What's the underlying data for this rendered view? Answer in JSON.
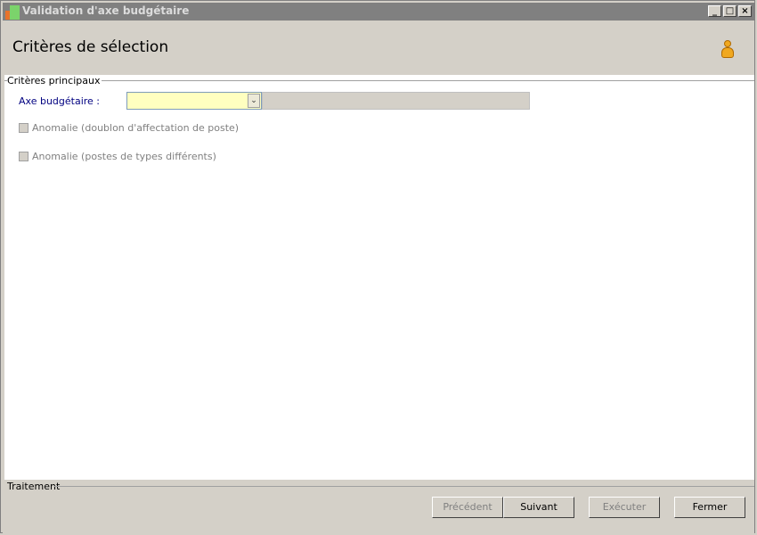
{
  "window": {
    "title": "Validation d'axe budgétaire",
    "buttons": {
      "minimize": "_",
      "maximize": "□",
      "close": "×"
    }
  },
  "header": {
    "title": "Critères de sélection",
    "icon": "user-icon"
  },
  "main": {
    "group_label": "Critères principaux",
    "axe_label": "Axe budgétaire :",
    "axe_value": "",
    "axe_description": "",
    "checkboxes": [
      {
        "label": "Anomalie (doublon d'affectation de poste)",
        "checked": false,
        "enabled": false
      },
      {
        "label": "Anomalie (postes de types différents)",
        "checked": false,
        "enabled": false
      }
    ]
  },
  "footer": {
    "group_label": "Traitement",
    "buttons": {
      "previous": "Précédent",
      "next": "Suivant",
      "execute": "Exécuter",
      "close": "Fermer"
    }
  },
  "colors": {
    "input_bg": "#ffffc0",
    "label_blue": "#000080",
    "titlebar": "#808080"
  }
}
